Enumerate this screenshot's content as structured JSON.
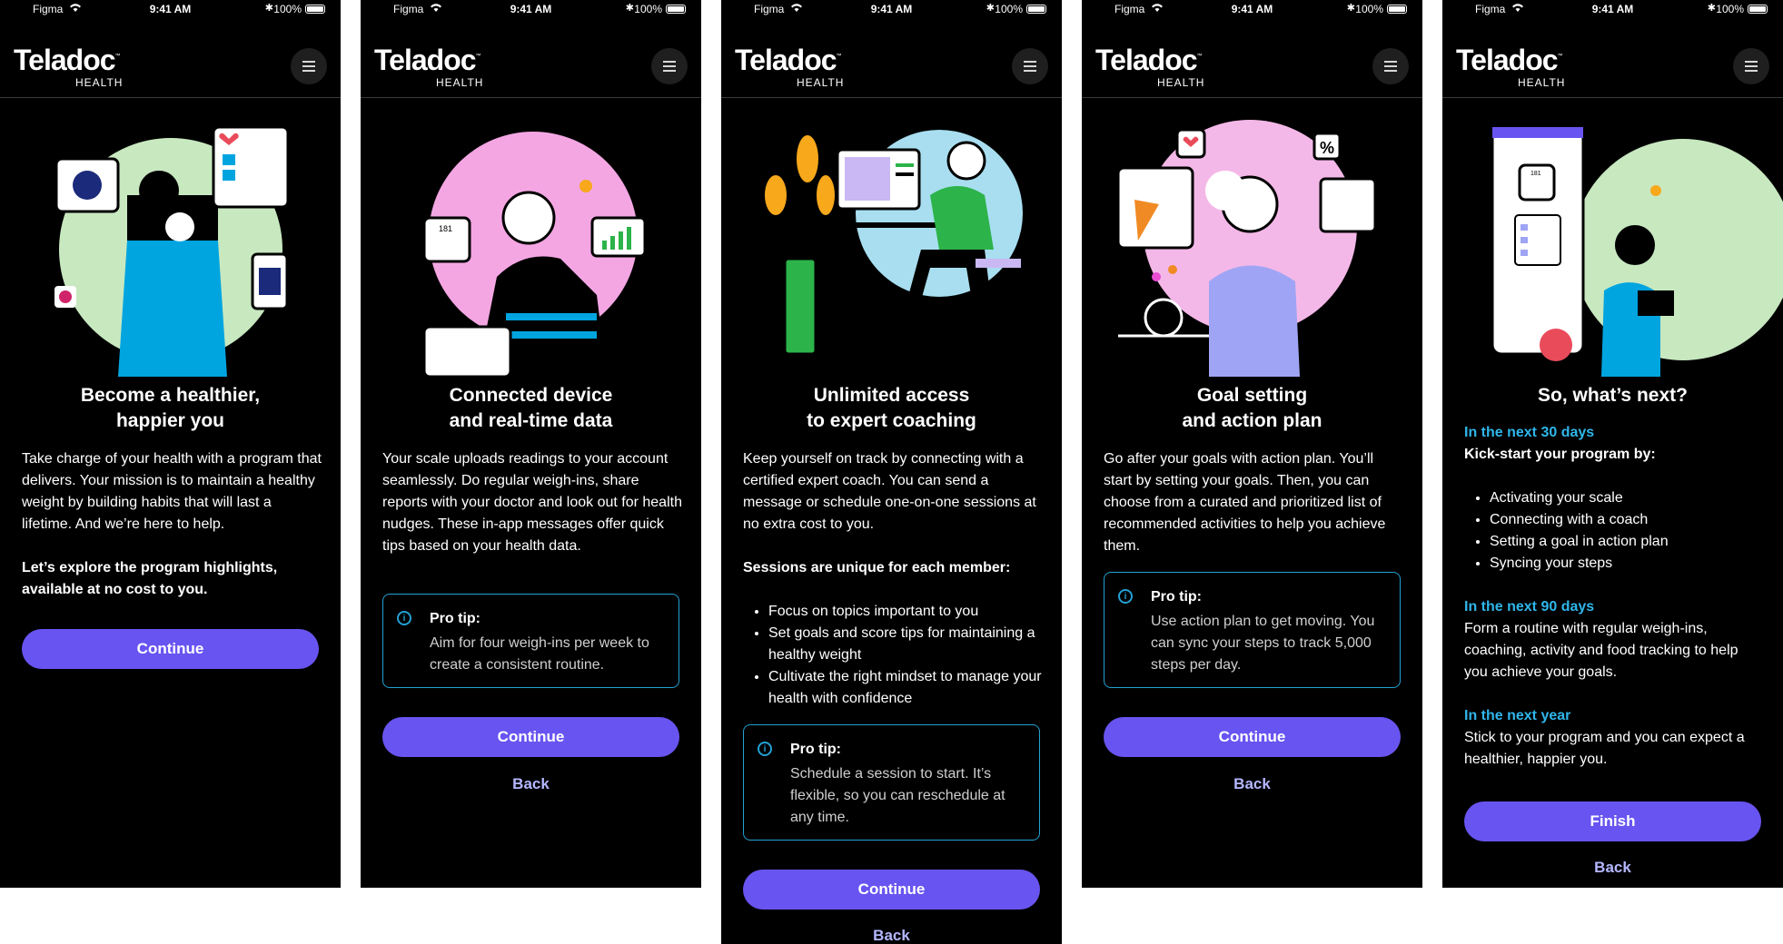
{
  "status": {
    "carrier": "Figma",
    "time": "9:41 AM",
    "battery": "100%",
    "bluetooth": "✱"
  },
  "brand": {
    "logo": "Teladoc",
    "sub": "HEALTH",
    "tm": "™"
  },
  "colors": {
    "background": "#000000",
    "accent": "#6854f0",
    "info": "#23a1d4",
    "link": "#b4b7ff",
    "highlight": "#2fb6ea"
  },
  "icons": {
    "menu": "hamburger-icon",
    "info": "info-icon",
    "wifi": "wifi-icon",
    "battery": "battery-icon"
  },
  "screens": [
    {
      "title_l1": "Become a healthier,",
      "title_l2": "happier you",
      "body": "Take charge of your health with a program that delivers. Your mission is to maintain a healthy weight by building habits that will last a lifetime. And we’re here to help.",
      "emph": "Let’s explore the program highlights, available at no cost to you.",
      "cta": "Continue"
    },
    {
      "title_l1": "Connected device",
      "title_l2": "and real-time data",
      "body": "Your scale uploads readings to your account seamlessly. Do regular weigh-ins, share reports with your doctor and look out for health nudges. These in-app messages offer quick tips based on your health data.",
      "tip_title": "Pro tip:",
      "tip_text": "Aim for four weigh-ins per week to create a consistent routine.",
      "cta": "Continue",
      "back": "Back",
      "scale_label": "181"
    },
    {
      "title_l1": "Unlimited access",
      "title_l2": "to expert coaching",
      "body": "Keep yourself on track by connecting with a certified expert coach. You can send a message or schedule one-on-one sessions at no extra cost to you.",
      "list_heading": "Sessions are unique for each member:",
      "items": [
        "Focus on topics important to you",
        "Set goals and score tips for maintaining a healthy weight",
        "Cultivate the right mindset to manage your health with confidence"
      ],
      "tip_title": "Pro tip:",
      "tip_text": "Schedule a session to start. It’s flexible, so you can reschedule at any time.",
      "cta": "Continue",
      "back": "Back"
    },
    {
      "title_l1": "Goal setting",
      "title_l2": "and action plan",
      "body": "Go after your goals with action plan.  You’ll start by setting your goals. Then, you can choose from a curated and prioritized list of recommended activities to help you achieve them.",
      "tip_title": "Pro tip:",
      "tip_text": "Use action plan to get moving. You can sync your steps to track 5,000 steps per day.",
      "cta": "Continue",
      "back": "Back",
      "percent": "%"
    },
    {
      "title": "So, what’s next?",
      "s1_heading": "In the next 30 days",
      "s1_sub": "Kick-start your program by:",
      "s1_items": [
        "Activating your scale",
        "Connecting with a coach",
        "Setting a goal in action plan",
        "Syncing your steps"
      ],
      "s2_heading": "In the next 90 days",
      "s2_text": "Form a routine with regular weigh-ins, coaching, activity and food tracking to help you achieve your goals.",
      "s3_heading": "In the next year",
      "s3_text": "Stick to your program and you can expect a healthier, happier you.",
      "cta": "Finish",
      "back": "Back",
      "scale_label": "181"
    }
  ]
}
